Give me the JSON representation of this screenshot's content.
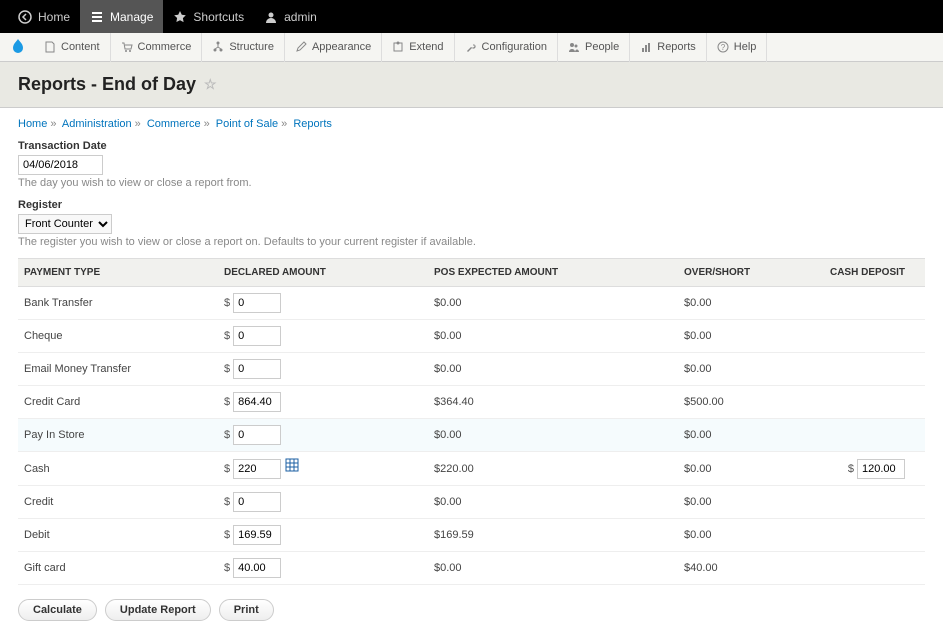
{
  "topbar": {
    "home": "Home",
    "manage": "Manage",
    "shortcuts": "Shortcuts",
    "user": "admin"
  },
  "secondbar": {
    "content": "Content",
    "commerce": "Commerce",
    "structure": "Structure",
    "appearance": "Appearance",
    "extend": "Extend",
    "configuration": "Configuration",
    "people": "People",
    "reports": "Reports",
    "help": "Help"
  },
  "page_title": "Reports - End of Day",
  "breadcrumb": {
    "home": "Home",
    "administration": "Administration",
    "commerce": "Commerce",
    "pos": "Point of Sale",
    "reports": "Reports"
  },
  "fields": {
    "date_label": "Transaction Date",
    "date_value": "04/06/2018",
    "date_desc": "The day you wish to view or close a report from.",
    "register_label": "Register",
    "register_value": "Front Counter",
    "register_desc": "The register you wish to view or close a report on. Defaults to your current register if available."
  },
  "table": {
    "headers": {
      "payment_type": "Payment Type",
      "declared": "Declared Amount",
      "expected": "POS Expected Amount",
      "over_short": "Over/Short",
      "deposit": "Cash Deposit"
    },
    "rows": [
      {
        "type": "Bank Transfer",
        "declared": "0",
        "expected": "$0.00",
        "over_short": "$0.00",
        "deposit": "",
        "has_grid": false
      },
      {
        "type": "Cheque",
        "declared": "0",
        "expected": "$0.00",
        "over_short": "$0.00",
        "deposit": "",
        "has_grid": false
      },
      {
        "type": "Email Money Transfer",
        "declared": "0",
        "expected": "$0.00",
        "over_short": "$0.00",
        "deposit": "",
        "has_grid": false
      },
      {
        "type": "Credit Card",
        "declared": "864.40",
        "expected": "$364.40",
        "over_short": "$500.00",
        "deposit": "",
        "has_grid": false
      },
      {
        "type": "Pay In Store",
        "declared": "0",
        "expected": "$0.00",
        "over_short": "$0.00",
        "deposit": "",
        "has_grid": false,
        "highlight": true
      },
      {
        "type": "Cash",
        "declared": "220",
        "expected": "$220.00",
        "over_short": "$0.00",
        "deposit": "120.00",
        "has_grid": true
      },
      {
        "type": "Credit",
        "declared": "0",
        "expected": "$0.00",
        "over_short": "$0.00",
        "deposit": "",
        "has_grid": false
      },
      {
        "type": "Debit",
        "declared": "169.59",
        "expected": "$169.59",
        "over_short": "$0.00",
        "deposit": "",
        "has_grid": false
      },
      {
        "type": "Gift card",
        "declared": "40.00",
        "expected": "$0.00",
        "over_short": "$40.00",
        "deposit": "",
        "has_grid": false
      }
    ]
  },
  "actions": {
    "calculate": "Calculate",
    "update": "Update Report",
    "print": "Print"
  }
}
